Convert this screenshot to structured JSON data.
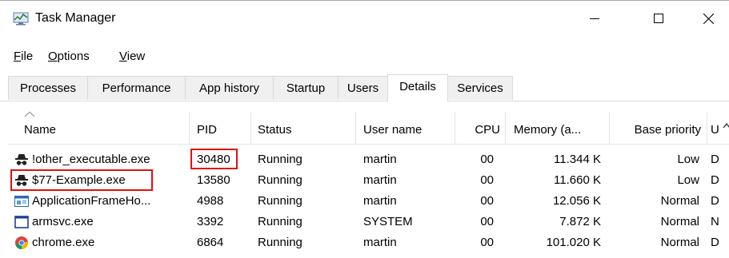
{
  "window": {
    "title": "Task Manager",
    "controls": {
      "minimize": "—",
      "maximize": "☐",
      "close": "✕"
    }
  },
  "menu": {
    "items": [
      {
        "label": "File",
        "hotkey": "F",
        "rest": "ile"
      },
      {
        "label": "Options",
        "hotkey": "O",
        "rest": "ptions"
      },
      {
        "label": "View",
        "hotkey": "V",
        "rest": "iew"
      }
    ]
  },
  "tabs": [
    {
      "label": "Processes"
    },
    {
      "label": "Performance"
    },
    {
      "label": "App history"
    },
    {
      "label": "Startup"
    },
    {
      "label": "Users"
    },
    {
      "label": "Details",
      "active": true
    },
    {
      "label": "Services"
    }
  ],
  "table": {
    "columns": [
      "Name",
      "PID",
      "Status",
      "User name",
      "CPU",
      "Memory (a...",
      "Base priority",
      "U"
    ],
    "rows": [
      {
        "name": "!other_executable.exe",
        "icon": "spy-icon",
        "pid": "30480",
        "status": "Running",
        "user": "martin",
        "cpu": "00",
        "memory": "11.344 K",
        "priority": "Low",
        "extra": "D"
      },
      {
        "name": "$77-Example.exe",
        "icon": "spy-icon",
        "pid": "13580",
        "status": "Running",
        "user": "martin",
        "cpu": "00",
        "memory": "11.660 K",
        "priority": "Low",
        "extra": "D"
      },
      {
        "name": "ApplicationFrameHo...",
        "icon": "app-frame-icon",
        "pid": "4988",
        "status": "Running",
        "user": "martin",
        "cpu": "00",
        "memory": "12.056 K",
        "priority": "Normal",
        "extra": "D"
      },
      {
        "name": "armsvc.exe",
        "icon": "window-icon",
        "pid": "3392",
        "status": "Running",
        "user": "SYSTEM",
        "cpu": "00",
        "memory": "7.872 K",
        "priority": "Normal",
        "extra": "N"
      },
      {
        "name": "chrome.exe",
        "icon": "chrome-icon",
        "pid": "6864",
        "status": "Running",
        "user": "martin",
        "cpu": "00",
        "memory": "101.020 K",
        "priority": "Normal",
        "extra": "D"
      }
    ]
  },
  "colors": {
    "highlight_box": "#e01010",
    "tab_border": "#d9d9d9",
    "inactive_tab": "#f0f0f0"
  }
}
